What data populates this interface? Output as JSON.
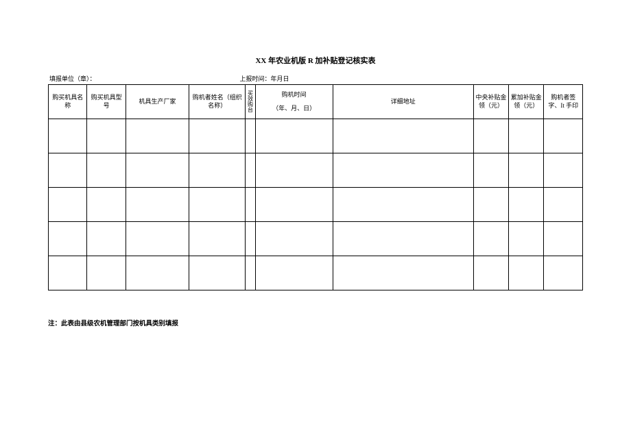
{
  "title": "XX 年农业机版 R 加补贴登记核实表",
  "meta": {
    "reporter_label": "填报单位（章）：",
    "date_label": "上报时间：年月日"
  },
  "headers": {
    "name": "购买机具名称",
    "model": "购买机具型号",
    "factory": "机具生产厂家",
    "buyer": "购机者姓名（组织名称）",
    "qty": "买效购台",
    "time_line1": "购机时间",
    "time_line2": "（年、月、日）",
    "addr": "详细地址",
    "central": "中央补贴金领（元）",
    "accum": "累加补贴金领（元）",
    "sign": "购机者签字、It 手印"
  },
  "rows": [
    {
      "name": "",
      "model": "",
      "factory": "",
      "buyer": "",
      "qty": "",
      "time": "",
      "addr": "",
      "central": "",
      "accum": "",
      "sign": ""
    },
    {
      "name": "",
      "model": "",
      "factory": "",
      "buyer": "",
      "qty": "",
      "time": "",
      "addr": "",
      "central": "",
      "accum": "",
      "sign": ""
    },
    {
      "name": "",
      "model": "",
      "factory": "",
      "buyer": "",
      "qty": "",
      "time": "",
      "addr": "",
      "central": "",
      "accum": "",
      "sign": ""
    },
    {
      "name": "",
      "model": "",
      "factory": "",
      "buyer": "",
      "qty": "",
      "time": "",
      "addr": "",
      "central": "",
      "accum": "",
      "sign": ""
    },
    {
      "name": "",
      "model": "",
      "factory": "",
      "buyer": "",
      "qty": "",
      "time": "",
      "addr": "",
      "central": "",
      "accum": "",
      "sign": ""
    }
  ],
  "footnote": "注：此表由县级农机管理部门按机具类别填报"
}
